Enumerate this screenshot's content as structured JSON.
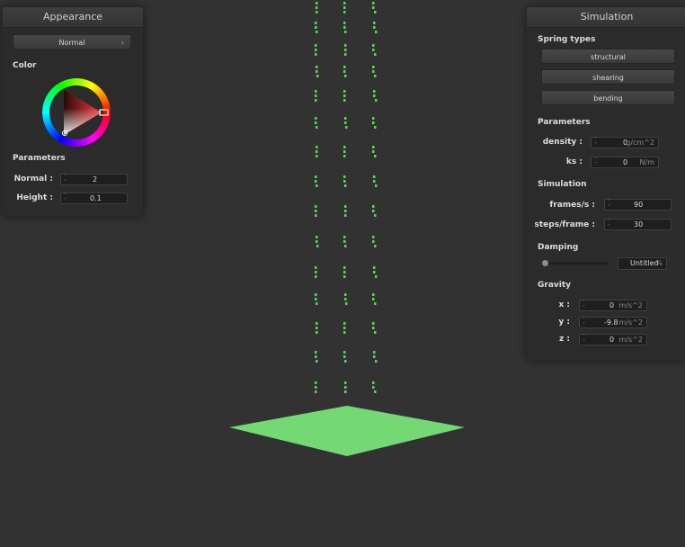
{
  "appearance_panel": {
    "title": "Appearance",
    "shading_mode": "Normal",
    "color_label": "Color",
    "parameters_label": "Parameters",
    "normal_label": "Normal :",
    "normal_value": "2",
    "height_label": "Height :",
    "height_value": "0.1",
    "selected_color": "#ff3c3c"
  },
  "simulation_panel": {
    "title": "Simulation",
    "spring_types_label": "Spring types",
    "spring_buttons": [
      "structural",
      "shearing",
      "bending"
    ],
    "parameters_label": "Parameters",
    "density_label": "density :",
    "density_value": "0",
    "density_unit": "g/cm^2",
    "ks_label": "ks :",
    "ks_value": "0",
    "ks_unit": "N/m",
    "simulation_label": "Simulation",
    "frames_label": "frames/s :",
    "frames_value": "90",
    "steps_label": "steps/frame :",
    "steps_value": "30",
    "damping_label": "Damping",
    "damping_level": 0,
    "damping_value": "Untitled",
    "damping_unit": "%",
    "gravity_label": "Gravity",
    "gravity_x_label": "x :",
    "gravity_x_value": "0",
    "gravity_y_label": "y :",
    "gravity_y_value": "-9.8",
    "gravity_z_label": "z :",
    "gravity_z_value": "0",
    "gravity_unit": "m/s^2"
  },
  "scene": {
    "cloth_color": "#59d659",
    "plane_color": "#74d874",
    "particle_columns": 3,
    "particle_rows": 15
  }
}
